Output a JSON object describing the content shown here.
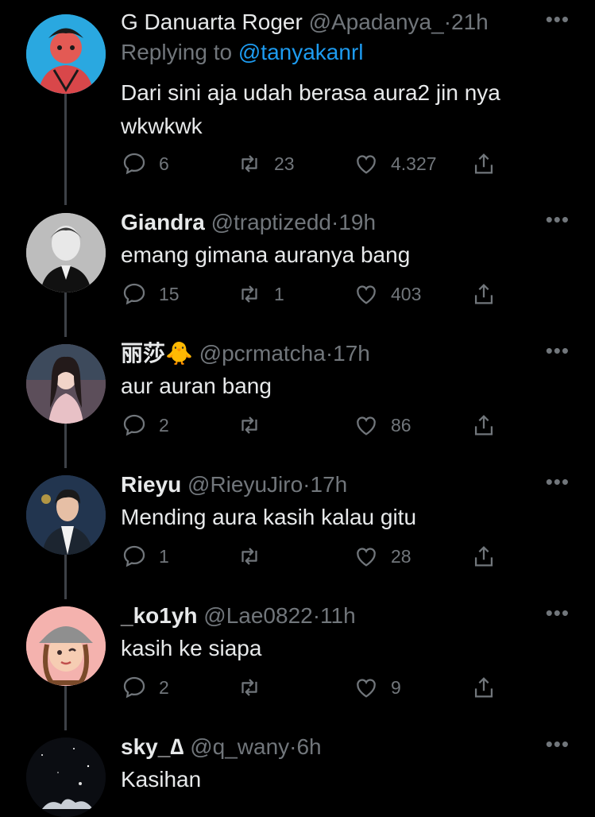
{
  "tweets": [
    {
      "name": "G Danuarta Roger",
      "handle": "@Apadanya_",
      "time": "21h",
      "replying_prefix": "Replying to",
      "replying_to": "@tanyakanrl",
      "text": "Dari sini aja udah berasa aura2 jin nya wkwkwk",
      "replies": "6",
      "retweets": "23",
      "likes": "4.327",
      "avatar_color": "#2aa8e0"
    },
    {
      "name": "Giandra",
      "handle": "@traptizedd",
      "time": "19h",
      "text": "emang gimana auranya bang",
      "replies": "15",
      "retweets": "1",
      "likes": "403",
      "avatar_color": "#cfcfcf"
    },
    {
      "name": "丽莎",
      "name_emoji": "🐥",
      "handle": "@pcrmatcha",
      "time": "17h",
      "text": "aur auran bang",
      "replies": "2",
      "retweets": "",
      "likes": "86",
      "avatar_color": "#6b5a66"
    },
    {
      "name": "Rieyu",
      "handle": "@RieyuJiro",
      "time": "17h",
      "text": "Mending aura kasih kalau gitu",
      "replies": "1",
      "retweets": "",
      "likes": "28",
      "avatar_color": "#2f4a6e"
    },
    {
      "name": "_ko1yh",
      "handle": "@Lae0822",
      "time": "11h",
      "text": "kasih ke siapa",
      "replies": "2",
      "retweets": "",
      "likes": "9",
      "avatar_color": "#f2a7a3"
    },
    {
      "name": "sky_∆",
      "handle": "@q_wany",
      "time": "6h",
      "text": "Kasihan",
      "avatar_color": "#0d0f14"
    }
  ],
  "ui": {
    "separator": "·",
    "more": "•••"
  }
}
